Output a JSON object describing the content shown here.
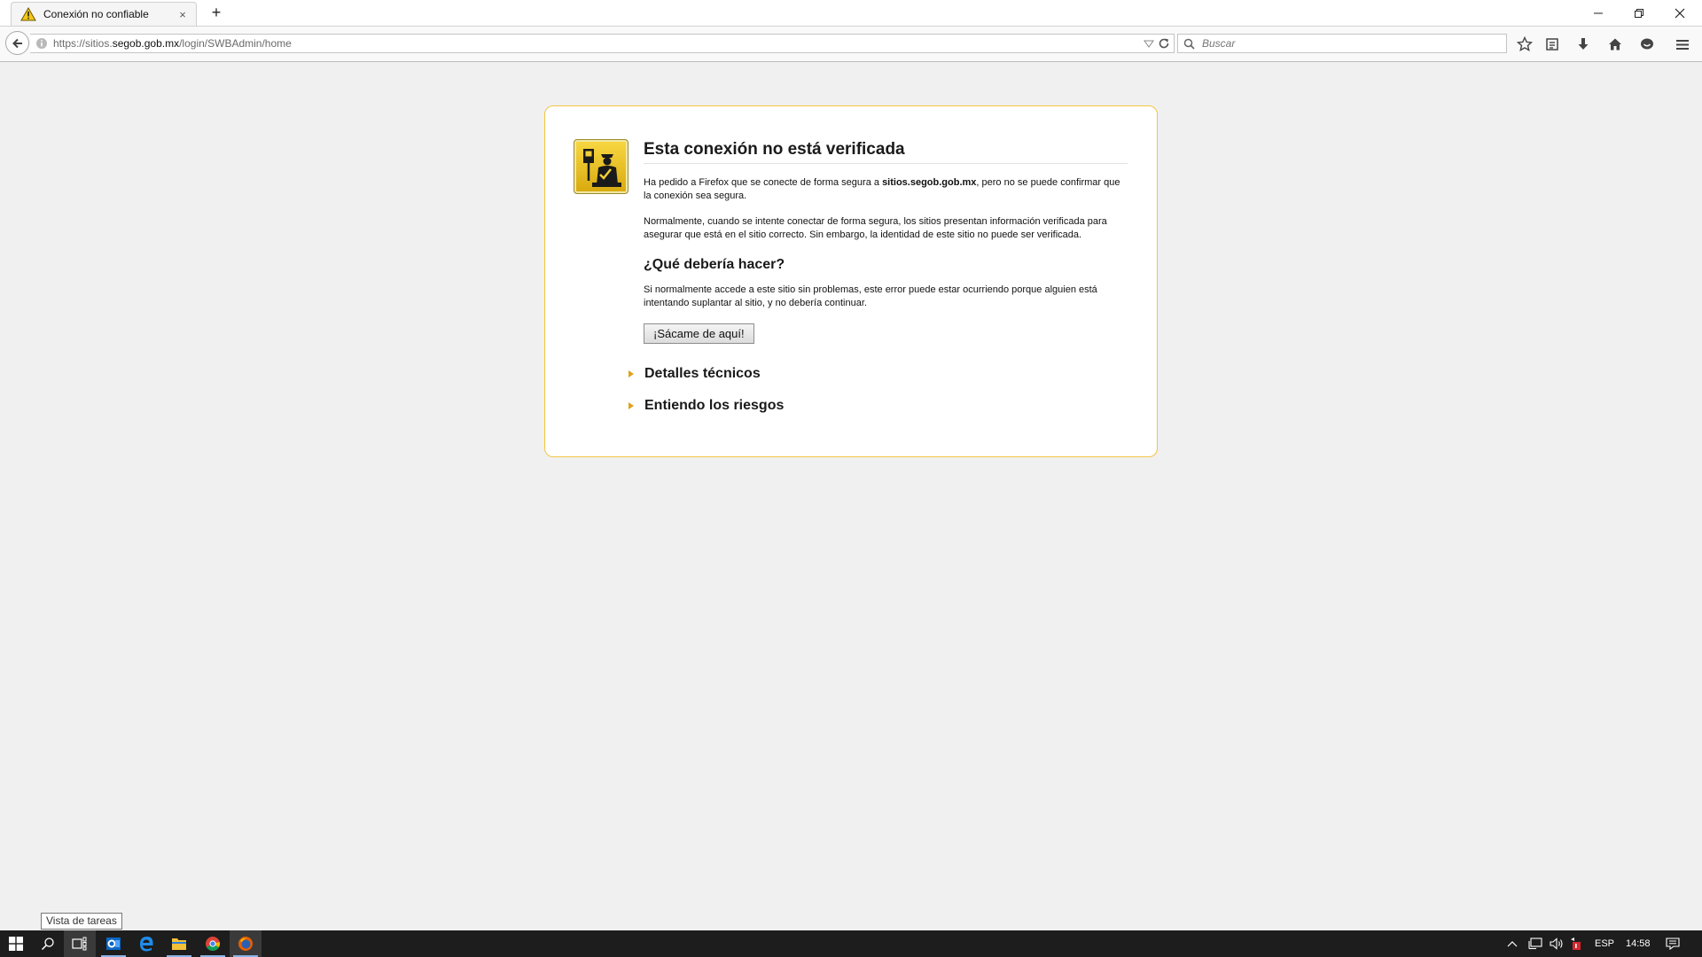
{
  "browser": {
    "tab": {
      "title": "Conexión no confiable",
      "close_glyph": "×",
      "icon": "warning-triangle-icon"
    },
    "new_tab_glyph": "+",
    "window_controls": [
      "minimize",
      "restore",
      "close"
    ],
    "url": {
      "prefix": "https://sitios.",
      "host": "segob.gob.mx",
      "path": "/login/SWBAdmin/home"
    },
    "search": {
      "placeholder": "Buscar"
    },
    "toolbar_icons": [
      "star-icon",
      "reading-list-icon",
      "download-icon",
      "home-icon",
      "chat-icon",
      "menu-icon"
    ]
  },
  "error_page": {
    "title": "Esta conexión no está verificada",
    "p1_before": "Ha pedido a Firefox que se conecte de forma segura a ",
    "p1_host": "sitios.segob.gob.mx",
    "p1_after": ", pero no se puede confirmar que la conexión sea segura.",
    "p2": "Normalmente, cuando se intente conectar de forma segura, los sitios presentan información verificada para asegurar que está en el sitio correcto. Sin embargo, la identidad de este sitio no puede ser verificada.",
    "heading": "¿Qué debería hacer?",
    "p3": "Si normalmente accede a este sitio sin problemas, este error puede estar ocurriendo porque alguien está intentando suplantar al sitio, y no debería continuar.",
    "escape_button": "¡Sácame de aquí!",
    "expanders": [
      "Detalles técnicos",
      "Entiendo los riesgos"
    ]
  },
  "tooltip": "Vista de tareas",
  "taskbar": {
    "apps": [
      "start-icon",
      "search-icon",
      "task-view-icon",
      "outlook-icon",
      "edge-icon",
      "file-explorer-icon",
      "chrome-icon",
      "firefox-icon"
    ],
    "language": "ESP",
    "clock": "14:58"
  },
  "colors": {
    "accent_border": "#f4c542",
    "triangle": "#e0a11a",
    "taskbar": "#1d1d1d"
  }
}
